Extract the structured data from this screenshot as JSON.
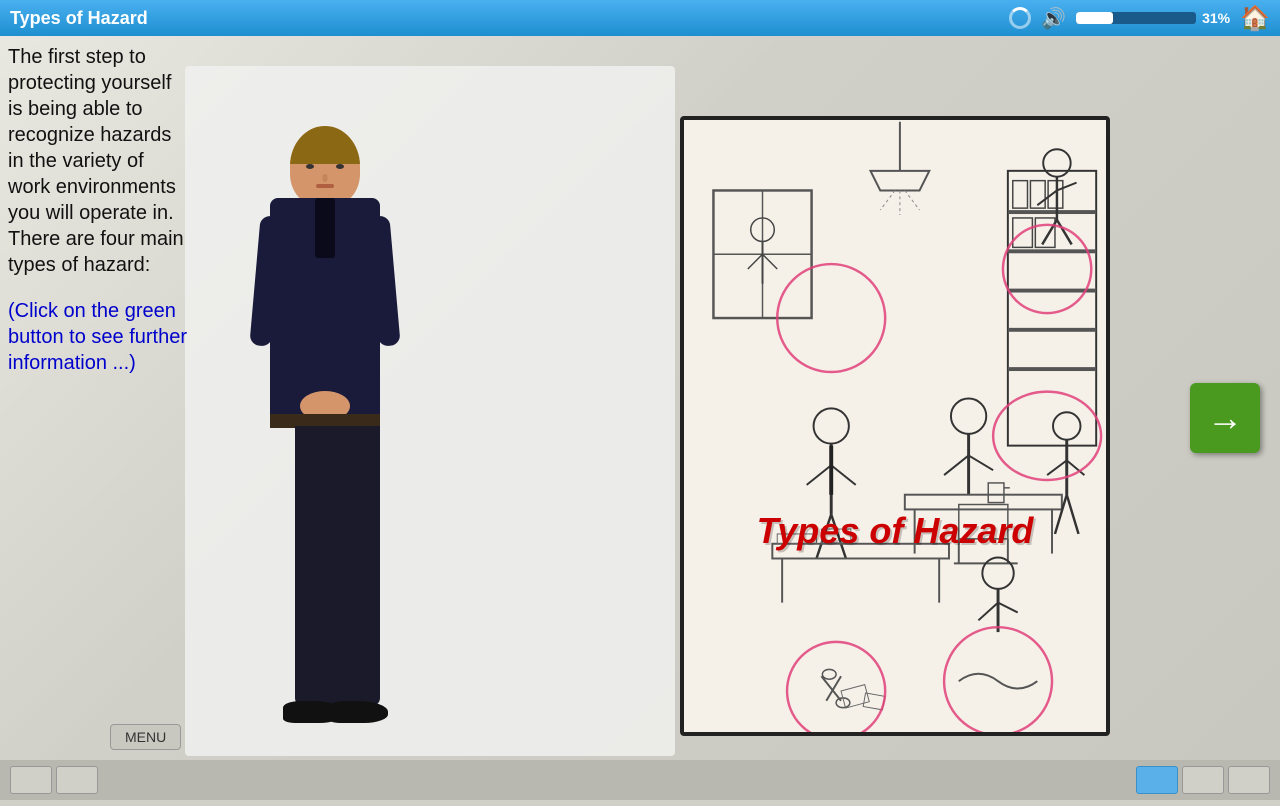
{
  "header": {
    "title": "Types of Hazard",
    "progress_percent": 31,
    "progress_label": "31%"
  },
  "main": {
    "body_text": "The first step to protecting yourself is being able to recognize hazards in the variety of work environments you will operate in. There are four main types of hazard:",
    "click_text": "(Click on the green button to see further information ...)",
    "hazard_image_title": "Types of Hazard",
    "menu_label": "MENU",
    "next_button_label": "→"
  },
  "bottom_nav": {
    "buttons": []
  }
}
